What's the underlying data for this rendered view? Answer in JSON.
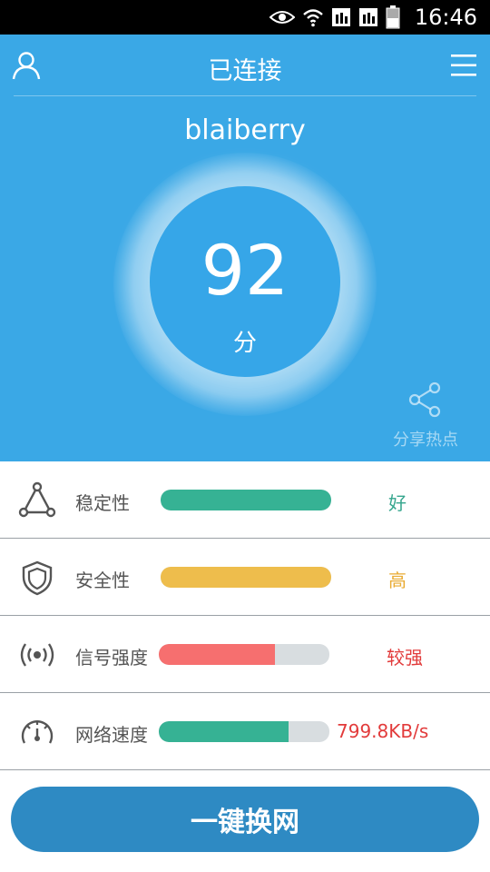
{
  "status_bar": {
    "time": "16:46",
    "icons": [
      "eye-icon",
      "wifi-icon",
      "sim1-icon",
      "sim2-icon",
      "battery-icon"
    ]
  },
  "header": {
    "title": "已连接",
    "left_icon": "user-icon",
    "right_icon": "menu-icon"
  },
  "network": {
    "ssid": "blaiberry",
    "score": "92",
    "score_unit": "分"
  },
  "share": {
    "icon": "share-icon",
    "label": "分享热点"
  },
  "metrics": [
    {
      "label": "稳定性",
      "value": "好",
      "fill": 1.0,
      "bar_color": "#36b294",
      "value_color": "#36a68e",
      "icon": "triangle-network-icon"
    },
    {
      "label": "安全性",
      "value": "高",
      "fill": 1.0,
      "bar_color": "#eebd4c",
      "value_color": "#e9ab33",
      "icon": "shield-icon"
    },
    {
      "label": "信号强度",
      "value": "较强",
      "fill": 0.68,
      "bar_color": "#f66f6f",
      "value_color": "#e23b3b",
      "icon": "signal-icon"
    },
    {
      "label": "网络速度",
      "value": "799.8KB/s",
      "fill": 0.76,
      "bar_color": "#36b294",
      "value_color": "#e23b3b",
      "icon": "speedometer-icon"
    }
  ],
  "action": {
    "label": "一键换网"
  },
  "colors": {
    "hero": "#3aa8e6",
    "button": "#2e8ac3"
  }
}
